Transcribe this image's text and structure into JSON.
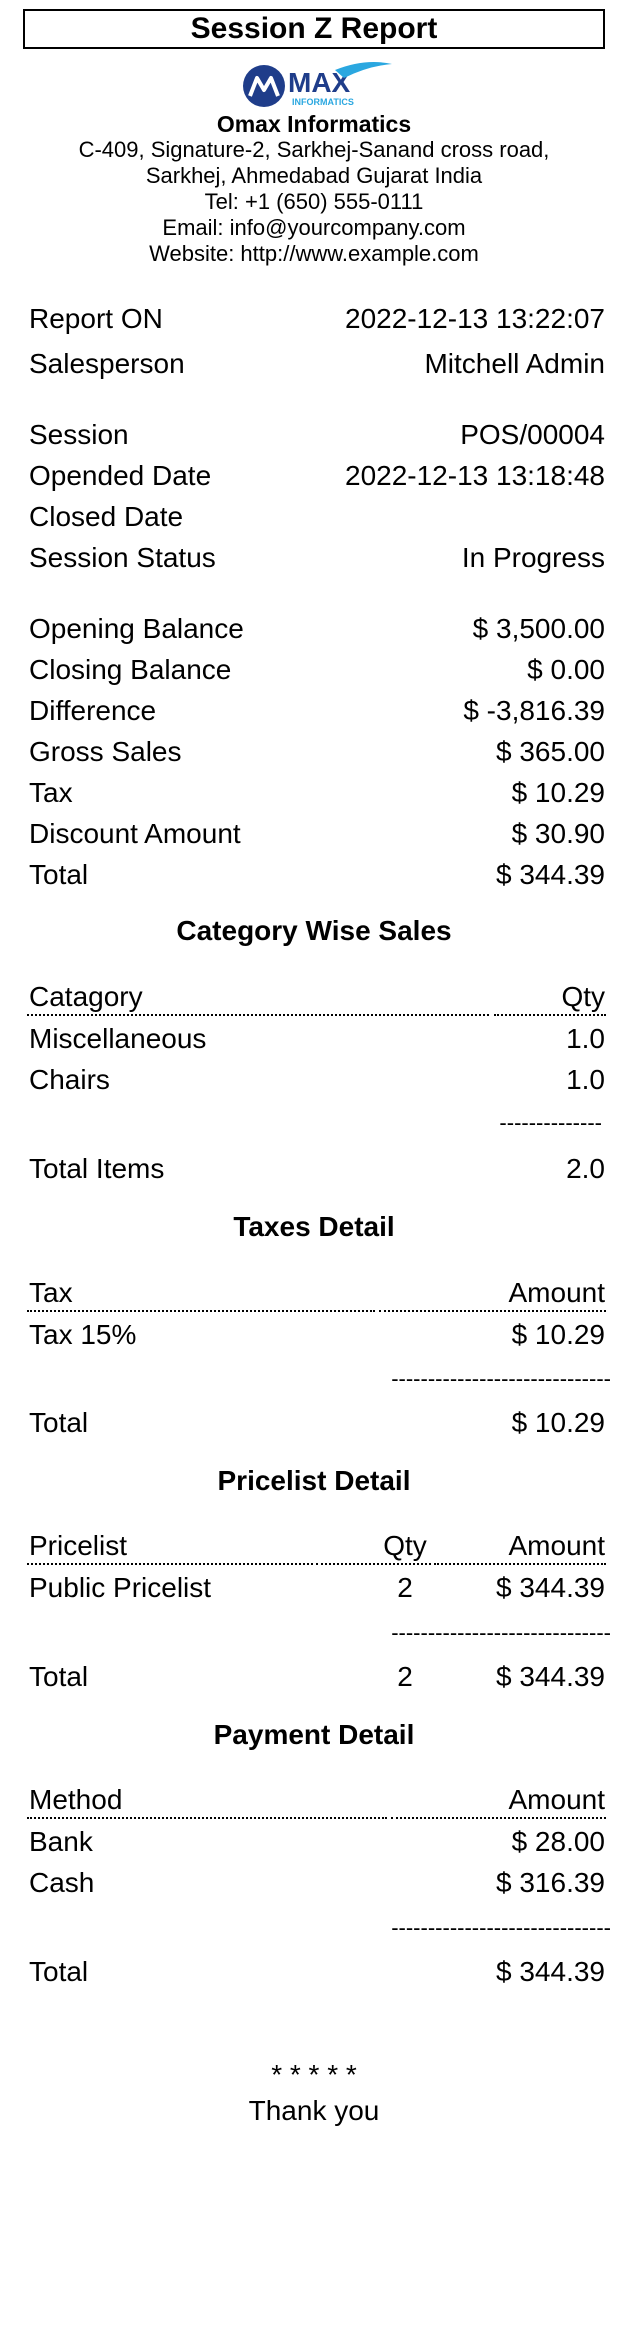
{
  "report_title": "Session Z Report",
  "logo": {
    "text": "MAX",
    "subtext": "INFORMATICS"
  },
  "company": {
    "name": "Omax Informatics",
    "address_line1": "C-409, Signature-2, Sarkhej-Sanand cross road,",
    "address_line2": "Sarkhej, Ahmedabad Gujarat India",
    "tel": "Tel: +1 (650) 555-0111",
    "email": "Email: info@yourcompany.com",
    "website": "Website: http://www.example.com"
  },
  "report_info": [
    {
      "label": "Report ON",
      "value": "2022-12-13 13:22:07"
    },
    {
      "label": "Salesperson",
      "value": "Mitchell Admin"
    }
  ],
  "session_info": [
    {
      "label": "Session",
      "value": "POS/00004"
    },
    {
      "label": "Opended Date",
      "value": "2022-12-13 13:18:48"
    },
    {
      "label": "Closed Date",
      "value": ""
    },
    {
      "label": "Session Status",
      "value": "In Progress"
    }
  ],
  "balances": [
    {
      "label": "Opening Balance",
      "value": "$ 3,500.00"
    },
    {
      "label": "Closing Balance",
      "value": "$ 0.00"
    },
    {
      "label": "Difference",
      "value": "$ -3,816.39"
    },
    {
      "label": "Gross Sales",
      "value": "$ 365.00"
    },
    {
      "label": "Tax",
      "value": "$ 10.29"
    },
    {
      "label": "Discount Amount",
      "value": "$ 30.90"
    },
    {
      "label": "Total",
      "value": "$ 344.39"
    }
  ],
  "category_sales": {
    "title": "Category Wise Sales",
    "col_name": "Catagory",
    "col_qty": "Qty",
    "rows": [
      {
        "name": "Miscellaneous",
        "qty": "1.0"
      },
      {
        "name": "Chairs",
        "qty": "1.0"
      }
    ],
    "separator": "--------------",
    "total_label": "Total Items",
    "total_value": "2.0"
  },
  "taxes": {
    "title": "Taxes Detail",
    "col_name": "Tax",
    "col_amount": "Amount",
    "rows": [
      {
        "name": "Tax 15%",
        "amount": "$ 10.29"
      }
    ],
    "separator": "------------------------------",
    "total_label": "Total",
    "total_value": "$ 10.29"
  },
  "pricelist": {
    "title": "Pricelist Detail",
    "col_name": "Pricelist",
    "col_qty": "Qty",
    "col_amount": "Amount",
    "rows": [
      {
        "name": "Public Pricelist",
        "qty": "2",
        "amount": "$ 344.39"
      }
    ],
    "separator": "------------------------------",
    "total_label": "Total",
    "total_qty": "2",
    "total_value": "$ 344.39"
  },
  "payment": {
    "title": "Payment Detail",
    "col_name": "Method",
    "col_amount": "Amount",
    "rows": [
      {
        "name": "Bank",
        "amount": "$ 28.00"
      },
      {
        "name": "Cash",
        "amount": "$ 316.39"
      }
    ],
    "separator": "------------------------------",
    "total_label": "Total",
    "total_value": "$ 344.39"
  },
  "footer": {
    "stars": "* * * * *",
    "thanks": "Thank you"
  },
  "colors": {
    "logo_dark": "#1f3d8a",
    "logo_light": "#2aa7e0"
  }
}
